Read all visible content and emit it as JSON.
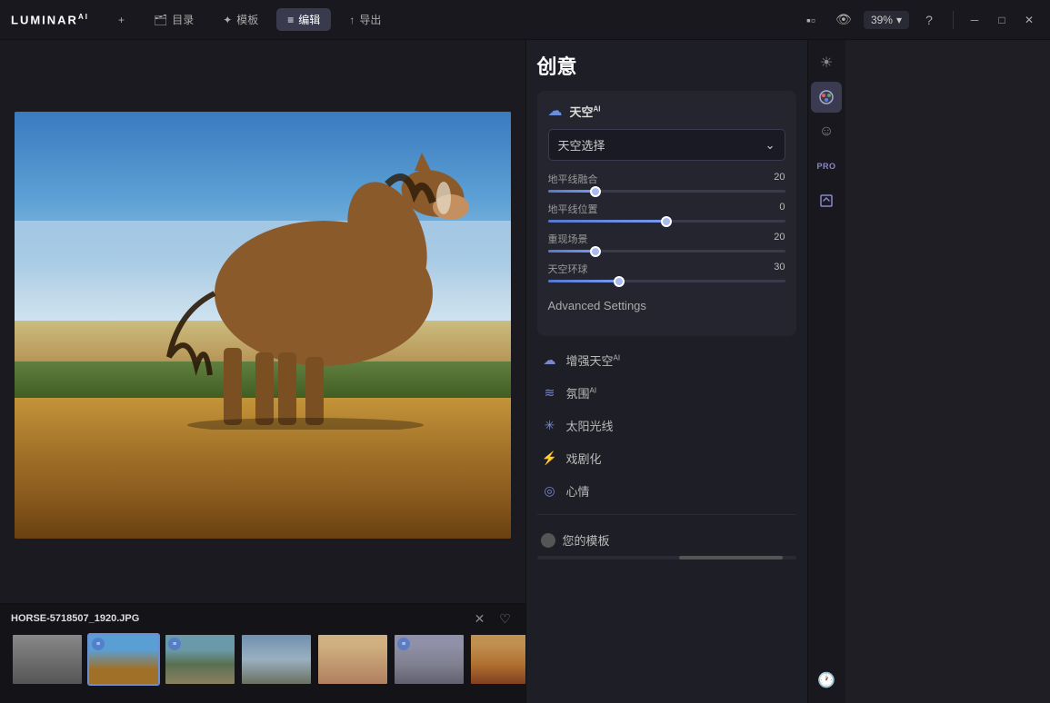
{
  "app": {
    "logo": "LUMINAR",
    "logo_sup": "AI"
  },
  "titlebar": {
    "add_label": "+",
    "catalog_label": "目录",
    "templates_label": "模板",
    "edit_label": "编辑",
    "export_label": "导出",
    "zoom_label": "39%",
    "help_icon": "?",
    "minimize_icon": "─",
    "maximize_icon": "□",
    "close_icon": "✕"
  },
  "panel": {
    "title": "创意",
    "sky_card": {
      "title": "天空",
      "title_sup": "AI",
      "dropdown_label": "天空选择",
      "sliders": [
        {
          "label": "地平线融合",
          "value": 20,
          "pct": 20
        },
        {
          "label": "地平线位置",
          "value": 0,
          "pct": 50
        },
        {
          "label": "重现场景",
          "value": 20,
          "pct": 20
        },
        {
          "label": "天空环球",
          "value": 30,
          "pct": 30
        }
      ]
    },
    "advanced_settings_label": "Advanced Settings",
    "expand_items": [
      {
        "icon": "☁",
        "label": "增强天空AI"
      },
      {
        "icon": "≋",
        "label": "氛围AI"
      },
      {
        "icon": "✳",
        "label": "太阳光线"
      },
      {
        "icon": "⚡",
        "label": "戏剧化"
      },
      {
        "icon": "◎",
        "label": "心情"
      }
    ],
    "templates_label": "您的模板"
  },
  "sidebar_icons": [
    {
      "icon": "☀",
      "label": "sun-icon",
      "active": false
    },
    {
      "icon": "🎨",
      "label": "palette-icon",
      "active": true
    },
    {
      "icon": "☺",
      "label": "face-icon",
      "active": false
    },
    {
      "icon": "PRO",
      "label": "pro-badge",
      "active": false
    },
    {
      "icon": "A",
      "label": "text-icon",
      "active": false
    },
    {
      "icon": "🕐",
      "label": "history-icon",
      "active": false
    }
  ],
  "filmstrip": {
    "filename": "HORSE-5718507_1920.JPG",
    "thumbs": [
      {
        "id": 1,
        "bg": "#888",
        "has_icon": false,
        "active": false
      },
      {
        "id": 2,
        "bg": "#a0785a",
        "has_icon": true,
        "active": true
      },
      {
        "id": 3,
        "bg": "#6a8a70",
        "has_icon": false,
        "active": false
      },
      {
        "id": 4,
        "bg": "#5a7090",
        "has_icon": false,
        "active": false
      },
      {
        "id": 5,
        "bg": "#c09870",
        "has_icon": false,
        "active": false
      },
      {
        "id": 6,
        "bg": "#808098",
        "has_icon": true,
        "active": false
      },
      {
        "id": 7,
        "bg": "#c09050",
        "has_icon": false,
        "active": false
      },
      {
        "id": 8,
        "bg": "#9090a0",
        "has_icon": false,
        "active": false
      }
    ]
  },
  "colors": {
    "accent": "#6a8fd8",
    "bg_dark": "#18181e",
    "bg_card": "#252530",
    "slider_fill": "#5577cc"
  }
}
